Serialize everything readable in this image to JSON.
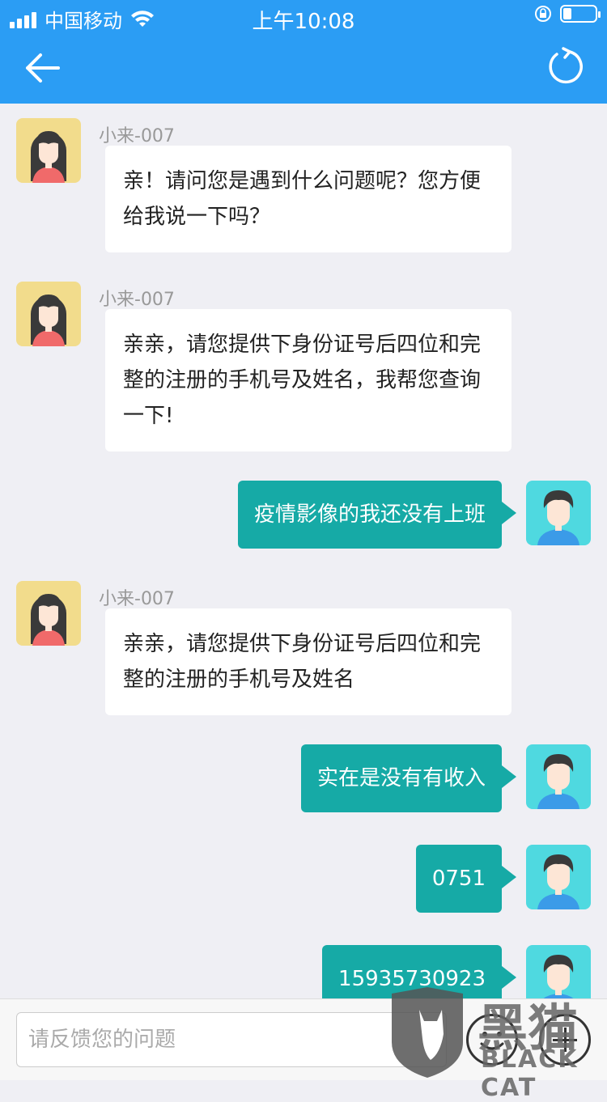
{
  "status_bar": {
    "carrier": "中国移动",
    "time": "上午10:08"
  },
  "nav": {
    "back_icon": "back-arrow-icon",
    "refresh_icon": "refresh-icon"
  },
  "messages": [
    {
      "from": "agent",
      "name": "小来-007",
      "text": "亲！请问您是遇到什么问题呢？您方便给我说一下吗？"
    },
    {
      "from": "agent",
      "name": "小来-007",
      "text": "亲亲，请您提供下身份证号后四位和完整的注册的手机号及姓名，我帮您查询一下!"
    },
    {
      "from": "user",
      "text": "疫情影像的我还没有上班"
    },
    {
      "from": "agent",
      "name": "小来-007",
      "text": "亲亲，请您提供下身份证号后四位和完整的注册的手机号及姓名"
    },
    {
      "from": "user",
      "text": "实在是没有有收入"
    },
    {
      "from": "user",
      "text": "0751"
    },
    {
      "from": "user",
      "text": "15935730923"
    }
  ],
  "input": {
    "placeholder": "请反馈您的问题"
  },
  "watermark": {
    "cn": "黑猫",
    "en": "BLACK CAT"
  },
  "colors": {
    "header": "#2b9df4",
    "outgoing_bubble": "#16aaa6",
    "incoming_bubble": "#ffffff",
    "background": "#efeff4"
  }
}
